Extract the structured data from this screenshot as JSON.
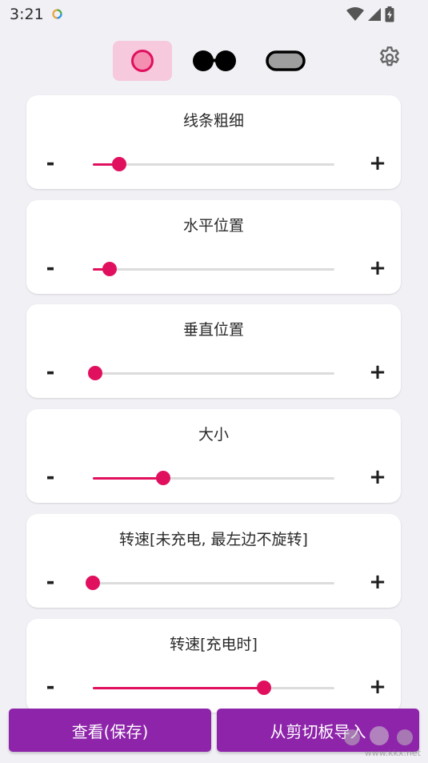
{
  "status_bar": {
    "time": "3:21"
  },
  "shape_selector": {
    "options": [
      {
        "name": "circle",
        "selected": true
      },
      {
        "name": "glasses",
        "selected": false
      },
      {
        "name": "pill",
        "selected": false
      }
    ],
    "settings_icon": "gear-icon"
  },
  "sliders": [
    {
      "title": "线条粗细",
      "minus": "-",
      "plus": "+",
      "value_fraction": 0.11
    },
    {
      "title": "水平位置",
      "minus": "-",
      "plus": "+",
      "value_fraction": 0.07
    },
    {
      "title": "垂直位置",
      "minus": "-",
      "plus": "+",
      "value_fraction": 0.01
    },
    {
      "title": "大小",
      "minus": "-",
      "plus": "+",
      "value_fraction": 0.29
    },
    {
      "title": "转速[未充电, 最左边不旋转]",
      "minus": "-",
      "plus": "+",
      "value_fraction": 0.0
    },
    {
      "title": "转速[充电时]",
      "minus": "-",
      "plus": "+",
      "value_fraction": 0.71
    }
  ],
  "buttons": {
    "view_save": "查看(保存)",
    "import_clipboard": "从剪切板导入"
  },
  "watermark": {
    "text": "www.kkx.net"
  },
  "colors": {
    "accent": "#e0105e",
    "button": "#8e24aa",
    "selected_bg": "#f6c9dc"
  }
}
